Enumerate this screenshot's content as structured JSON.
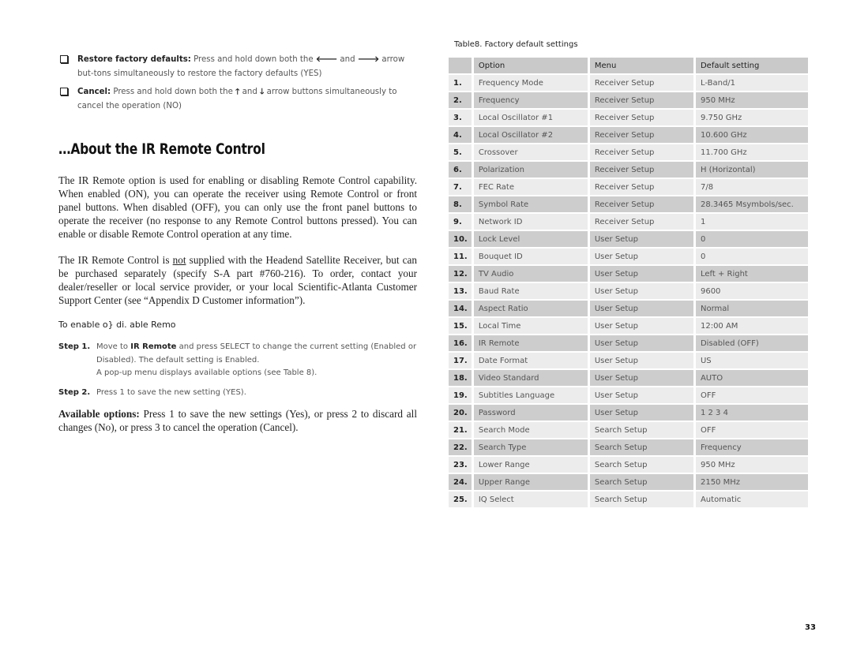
{
  "bullets": [
    {
      "icon": "checkbox-icon",
      "label": "Restore factory defaults:",
      "text_before": " Press and hold down both the ",
      "arrow1": "🡐",
      "arrow1_name": "left-arrow-icon",
      "mid": " and ",
      "arrow2": "🡒",
      "arrow2_name": "right-arrow-icon",
      "text_after": " arrow but-tons simultaneously to restore the factory defaults (YES)"
    },
    {
      "icon": "checkbox-icon",
      "label": "Cancel:",
      "text_before": " Press and hold down both the ",
      "arrow1": "🡑",
      "arrow1_name": "up-arrow-icon",
      "mid": " and ",
      "arrow2": "🡓",
      "arrow2_name": "down-arrow-icon",
      "text_after": " arrow buttons simultaneously to cancel the operation (NO)"
    }
  ],
  "section_title": "…About the IR Remote Control",
  "paragraph1": "The IR Remote option is used for enabling or disabling Remote Control capability. When enabled (ON), you can operate the receiver using Remote Control or front panel buttons. When disabled (OFF), you can only use the front panel buttons to operate the receiver (no response to any Remote Control buttons pressed). You can enable or disable Remote Control operation at any time.",
  "paragraph2": {
    "before": "The IR Remote Control is ",
    "underlined": "not",
    "after": " supplied with the Headend Satellite Receiver, but can be purchased separately (specify S-A part #760-216). To order, contact your dealer/reseller or local service provider, or your local Scientific-Atlanta Customer Support Center (see “Appendix D  Customer information”)."
  },
  "subheading": "To enable o} di. able Remo",
  "steps": [
    {
      "label": "Step 1.",
      "before": "Move to ",
      "bold": "IR Remote",
      "after": " and press SELECT to change the current setting (Enabled or Disabled). The default setting is Enabled.",
      "extra": "A pop-up menu displays available options (see Table 8)."
    },
    {
      "label": "Step 2.",
      "before": "Press 1 to save the new setting (YES).",
      "bold": "",
      "after": "",
      "extra": ""
    }
  ],
  "available_options": {
    "label": "Available options:",
    "text": " Press 1 to save the new settings (Yes), or press 2 to discard all changes (No), or press 3 to cancel the operation  (Cancel)."
  },
  "table": {
    "caption": "Table8. Factory default settings",
    "headers": [
      "",
      "Option",
      "Menu",
      "Default setting"
    ],
    "rows": [
      [
        "1.",
        "Frequency Mode",
        "Receiver Setup",
        "L-Band/1"
      ],
      [
        "2.",
        "Frequency",
        "Receiver Setup",
        "950 MHz"
      ],
      [
        "3.",
        "Local Oscillator #1",
        "Receiver Setup",
        "9.750 GHz"
      ],
      [
        "4.",
        "Local Oscillator #2",
        "Receiver Setup",
        "10.600 GHz"
      ],
      [
        "5.",
        "Crossover",
        "Receiver Setup",
        "11.700 GHz"
      ],
      [
        "6.",
        "Polarization",
        "Receiver Setup",
        "H (Horizontal)"
      ],
      [
        "7.",
        "FEC Rate",
        "Receiver Setup",
        "7/8"
      ],
      [
        "8.",
        "Symbol Rate",
        "Receiver Setup",
        "28.3465 Msymbols/sec."
      ],
      [
        "9.",
        "Network ID",
        "Receiver Setup",
        "1"
      ],
      [
        "10.",
        "Lock Level",
        "User Setup",
        "0"
      ],
      [
        "11.",
        "Bouquet ID",
        "User Setup",
        "0"
      ],
      [
        "12.",
        "TV Audio",
        "User Setup",
        "Left + Right"
      ],
      [
        "13.",
        "Baud Rate",
        "User Setup",
        "9600"
      ],
      [
        "14.",
        "Aspect Ratio",
        "User Setup",
        "Normal"
      ],
      [
        "15.",
        "Local Time",
        "User Setup",
        "12:00 AM"
      ],
      [
        "16.",
        "IR Remote",
        "User Setup",
        "Disabled (OFF)"
      ],
      [
        "17.",
        "Date Format",
        "User Setup",
        "US"
      ],
      [
        "18.",
        "Video Standard",
        "User Setup",
        "AUTO"
      ],
      [
        "19.",
        "Subtitles Language",
        "User Setup",
        "OFF"
      ],
      [
        "20.",
        "Password",
        "User Setup",
        "1 2 3 4"
      ],
      [
        "21.",
        "Search Mode",
        "Search Setup",
        "OFF"
      ],
      [
        "22.",
        "Search Type",
        "Search Setup",
        "Frequency"
      ],
      [
        "23.",
        "Lower Range",
        "Search Setup",
        "950 MHz"
      ],
      [
        "24.",
        "Upper Range",
        "Search Setup",
        "2150 MHz"
      ],
      [
        "25.",
        "IQ Select",
        "Search Setup",
        "Automatic"
      ]
    ]
  },
  "page_number": "33"
}
